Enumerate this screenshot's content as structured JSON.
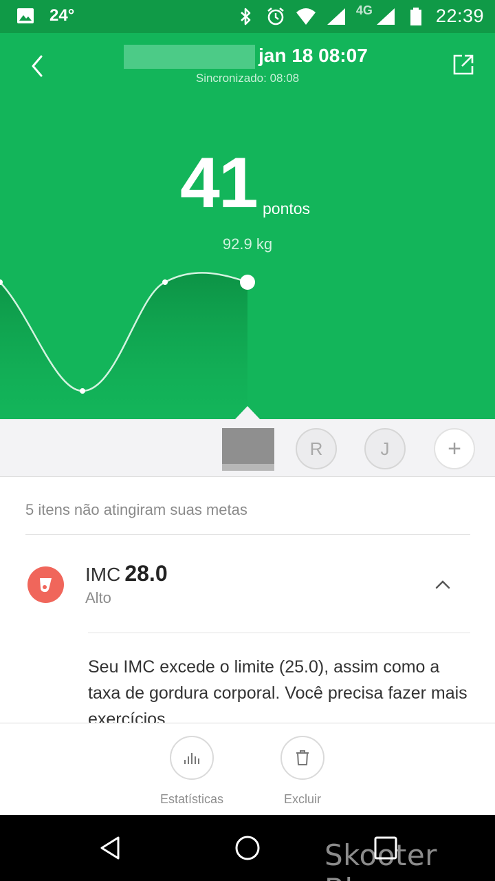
{
  "status_bar": {
    "temperature": "24°",
    "network": "4G",
    "time": "22:39",
    "icons": [
      "image-icon",
      "bluetooth-icon",
      "alarm-icon",
      "wifi-icon",
      "signal-icon",
      "battery-icon"
    ]
  },
  "header": {
    "date_time": "jan 18 08:07",
    "sync_status": "Sincronizado: 08:08",
    "score": "41",
    "score_unit": "pontos",
    "weight": "92.9 kg",
    "accent_color": "#13b55a"
  },
  "profiles": {
    "items": [
      {
        "initial": "R"
      },
      {
        "initial": "J"
      }
    ],
    "add_symbol": "+"
  },
  "content": {
    "summary": "5 itens não atingiram suas metas",
    "metric": {
      "name": "IMC",
      "value": "28.0",
      "status": "Alto",
      "icon_color": "#f0665b",
      "description": "Seu IMC excede o limite (25.0), assim como a taxa de gordura corporal. Você precisa fazer mais exercícios."
    }
  },
  "actions": {
    "stats_label": "Estatísticas",
    "delete_label": "Excluir"
  },
  "watermark": "Skooter Blog"
}
